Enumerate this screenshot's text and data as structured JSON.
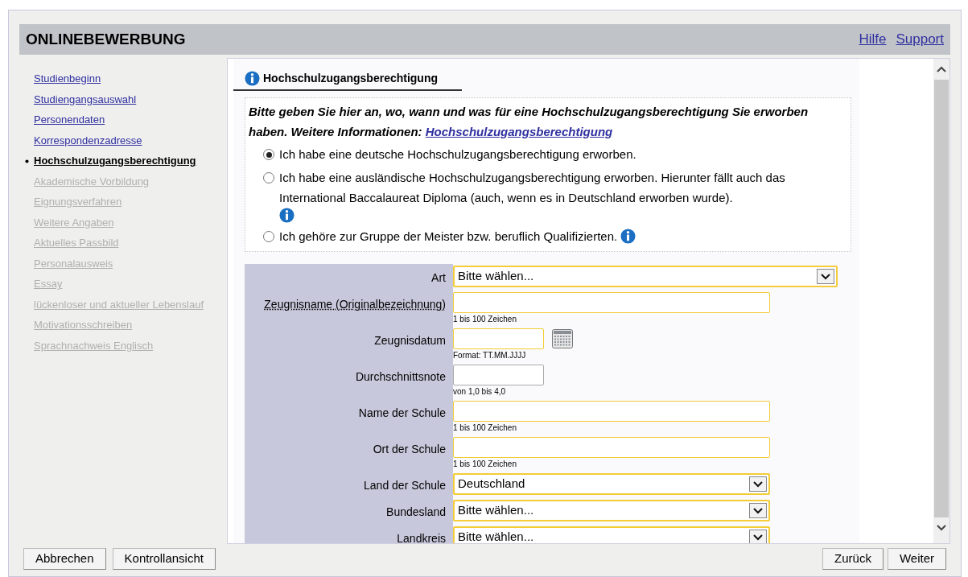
{
  "header": {
    "title": "ONLINEBEWERBUNG",
    "links": [
      "Hilfe",
      "Support"
    ]
  },
  "sidebar": {
    "items": [
      {
        "label": "Studienbeginn",
        "selected": false,
        "disabled": false
      },
      {
        "label": "Studiengangsauswahl",
        "selected": false,
        "disabled": false
      },
      {
        "label": "Personendaten",
        "selected": false,
        "disabled": false
      },
      {
        "label": "Korrespondenzadresse",
        "selected": false,
        "disabled": false
      },
      {
        "label": "Hochschulzugangsberechtigung",
        "selected": true,
        "disabled": false
      },
      {
        "label": "Akademische Vorbildung",
        "selected": false,
        "disabled": true
      },
      {
        "label": "Eignungsverfahren",
        "selected": false,
        "disabled": true
      },
      {
        "label": "Weitere Angaben",
        "selected": false,
        "disabled": true
      },
      {
        "label": "Aktuelles Passbild",
        "selected": false,
        "disabled": true
      },
      {
        "label": "Personalausweis",
        "selected": false,
        "disabled": true
      },
      {
        "label": "Essay",
        "selected": false,
        "disabled": true
      },
      {
        "label": "lückenloser und aktueller Lebenslauf",
        "selected": false,
        "disabled": true
      },
      {
        "label": "Motivationsschreiben",
        "selected": false,
        "disabled": true
      },
      {
        "label": "Sprachnachweis Englisch",
        "selected": false,
        "disabled": true
      }
    ]
  },
  "section": {
    "title": "Hochschulzugangsberechtigung",
    "intro": "Bitte geben Sie hier an, wo, wann und was für eine Hochschulzugangsberechtigung Sie erworben haben. Weitere Informationen:",
    "intro_link": "Hochschulzugangsberechtigung",
    "options": [
      {
        "label": "Ich habe eine deutsche Hochschulzugangsberechtigung erworben.",
        "selected": true,
        "info": false
      },
      {
        "label": "Ich habe eine ausländische Hochschulzugangsberechtigung erworben. Hierunter fällt auch das International Baccalaureat Diploma (auch, wenn es in Deutschland erworben wurde).",
        "selected": false,
        "info": true
      },
      {
        "label": "Ich gehöre zur Gruppe der Meister bzw. beruflich Qualifizierten.",
        "selected": false,
        "info": true
      }
    ]
  },
  "form": {
    "fields": [
      {
        "label": "Art",
        "kind": "combo",
        "value": "Bitte wählen...",
        "required": true
      },
      {
        "label": "Zeugnisname (Originalbezeichnung)",
        "kind": "text",
        "hint": "1 bis 100 Zeichen",
        "required": true,
        "tooltip": true
      },
      {
        "label": "Zeugnisdatum",
        "kind": "date",
        "hint": "Format: TT.MM.JJJJ",
        "required": true
      },
      {
        "label": "Durchschnittsnote",
        "kind": "grade",
        "hint": "von 1,0 bis 4,0",
        "required": false
      },
      {
        "label": "Name der Schule",
        "kind": "text",
        "hint": "1 bis 100 Zeichen",
        "required": true
      },
      {
        "label": "Ort der Schule",
        "kind": "text",
        "hint": "1 bis 100 Zeichen",
        "required": true
      },
      {
        "label": "Land der Schule",
        "kind": "select",
        "value": "Deutschland",
        "required": true
      },
      {
        "label": "Bundesland",
        "kind": "select",
        "value": "Bitte wählen...",
        "required": true
      },
      {
        "label": "Landkreis",
        "kind": "select",
        "value": "Bitte wählen...",
        "required": true
      }
    ]
  },
  "footer": {
    "left_buttons": [
      "Abbrechen",
      "Kontrollansicht"
    ],
    "right_buttons": [
      "Zurück",
      "Weiter"
    ]
  }
}
